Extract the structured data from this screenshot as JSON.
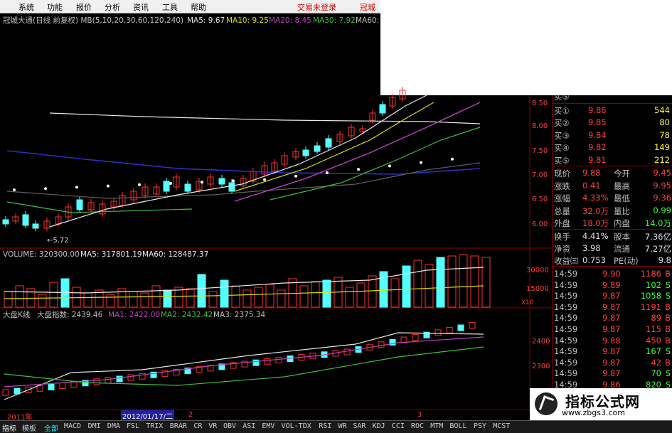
{
  "menu": {
    "items": [
      "系统",
      "功能",
      "报价",
      "分析",
      "资讯",
      "工具",
      "帮助"
    ],
    "login_status": "交易未登录",
    "broker": "冠城"
  },
  "main_chart": {
    "header_prefix": "冠城大通(日线 前复权) MB(5,10,20,30,60,120,240)",
    "ma5": "MA5: 9.67",
    "ma10": "MA10: 9.25",
    "ma20": "MA20: 8.45",
    "ma30": "MA30: 7.92",
    "ma60": "MA60:",
    "low_marker": "←5.72",
    "y_ticks": [
      "8.50",
      "8.00",
      "7.50",
      "7.00",
      "6.50",
      "6.00"
    ]
  },
  "volume_chart": {
    "header_label": "VOLUME: 320300.00",
    "ma5": "MA5: 317801.19",
    "ma60": "MA60: 128487.37",
    "y_ticks": [
      "30000",
      "15000"
    ],
    "unit": "X10"
  },
  "index_chart": {
    "header_label": "大盘K线",
    "index_label": "大盘指数: 2439.46",
    "ma1": "MA1: 2422.00",
    "ma2": "MA2: 2432.42",
    "ma3": "MA3: 2375.34",
    "y_ticks": [
      "2400",
      "2300"
    ]
  },
  "order_book": {
    "buy_top_label": "买⑤",
    "buy": [
      {
        "label": "买①",
        "price": "9.86",
        "vol": "544"
      },
      {
        "label": "买②",
        "price": "9.85",
        "vol": "80"
      },
      {
        "label": "买③",
        "price": "9.84",
        "vol": "78"
      },
      {
        "label": "买④",
        "price": "9.82",
        "vol": "149"
      },
      {
        "label": "买⑤",
        "price": "9.81",
        "vol": "212"
      }
    ],
    "stats": [
      {
        "l1": "现价",
        "v1": "9.88",
        "l2": "今开",
        "v2": "9.45"
      },
      {
        "l1": "涨跌",
        "v1": "0.41",
        "l2": "最高",
        "v2": "9.95"
      },
      {
        "l1": "涨幅",
        "v1": "4.33%",
        "l2": "最低",
        "v2": "9.36"
      },
      {
        "l1": "总量",
        "v1": "32.0万",
        "l2": "量比",
        "v2": "0.99"
      },
      {
        "l1": "外盘",
        "v1": "18.0万",
        "l2": "内盘",
        "v2": "14.0万"
      }
    ],
    "stats2": [
      {
        "l1": "换手",
        "v1": "4.41%",
        "l2": "股本",
        "v2": "7.36亿"
      },
      {
        "l1": "净资",
        "v1": "3.98",
        "l2": "流通",
        "v2": "7.27亿"
      },
      {
        "l1": "收益㈢",
        "v1": "0.753",
        "l2": "PE(动)",
        "v2": "9.8"
      }
    ],
    "ticks": [
      {
        "time": "14:59",
        "price": "9.90",
        "vol": "1186",
        "flag": "B"
      },
      {
        "time": "14:59",
        "price": "9.89",
        "vol": "102",
        "flag": "S"
      },
      {
        "time": "14:59",
        "price": "9.87",
        "vol": "1058",
        "flag": "S"
      },
      {
        "time": "14:59",
        "price": "9.87",
        "vol": "1191",
        "flag": "B"
      },
      {
        "time": "14:59",
        "price": "9.87",
        "vol": "89",
        "flag": "B"
      },
      {
        "time": "14:59",
        "price": "9.87",
        "vol": "115",
        "flag": "B"
      },
      {
        "time": "14:59",
        "price": "9.88",
        "vol": "450",
        "flag": "B"
      },
      {
        "time": "14:59",
        "price": "9.87",
        "vol": "167",
        "flag": "S"
      },
      {
        "time": "14:59",
        "price": "9.87",
        "vol": "42",
        "flag": "B"
      },
      {
        "time": "14:59",
        "price": "9.87",
        "vol": "70",
        "flag": "S"
      },
      {
        "time": "14:59",
        "price": "9.86",
        "vol": "820",
        "flag": "S"
      }
    ]
  },
  "date_bar": {
    "year": "2011年",
    "cursor_date": "2012/01/17/二",
    "month_a": "2",
    "month_b": "3"
  },
  "tabs": {
    "left": [
      "指标",
      "模板"
    ],
    "all": "全部",
    "indicators": [
      "MACD",
      "DMI",
      "DMA",
      "FSL",
      "TRIX",
      "BRAR",
      "CR",
      "VR",
      "OBV",
      "ASI",
      "EMV",
      "VOL-TDX",
      "RSI",
      "WR",
      "SAR",
      "KDJ",
      "CCI",
      "ROC",
      "MTM",
      "BOLL",
      "PSY",
      "MCST"
    ]
  },
  "watermark": {
    "title": "指标公式网",
    "url": "www.zbgs3.com"
  },
  "colors": {
    "up_red": "#ff3030",
    "down_cyan": "#54ffff",
    "ma_white": "#e8e8e8",
    "ma_yellow": "#e0e000",
    "ma_magenta": "#c040c0",
    "ma_green": "#40c040",
    "ma_blue": "#3030c0",
    "grid_red": "#8b0000"
  }
}
